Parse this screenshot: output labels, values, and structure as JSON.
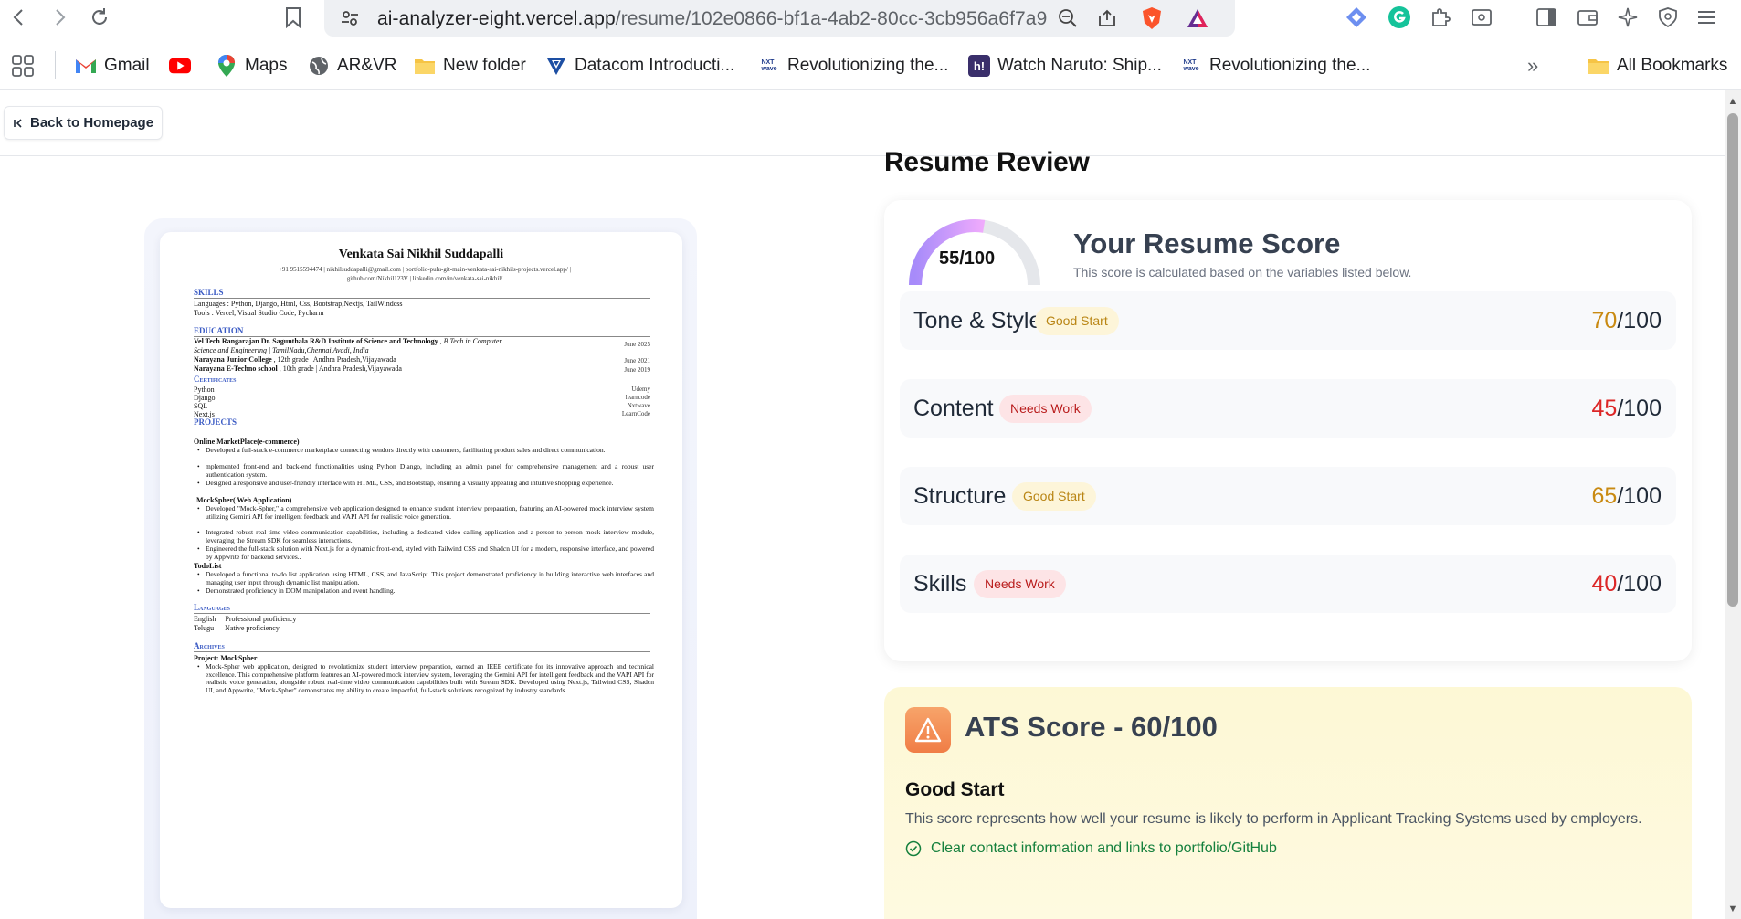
{
  "browser": {
    "url_host": "ai-analyzer-eight.vercel.app",
    "url_path": "/resume/102e0866-bf1a-4ab2-80cc-3cb956a6f7a9",
    "bookmarks": [
      {
        "label": "Gmail",
        "icon": "gmail-icon"
      },
      {
        "label": "",
        "icon": "youtube-icon"
      },
      {
        "label": "Maps",
        "icon": "maps-icon"
      },
      {
        "label": "AR&VR",
        "icon": "globe-icon"
      },
      {
        "label": "New folder",
        "icon": "folder-icon"
      },
      {
        "label": "Datacom Introducti...",
        "icon": "datacom-icon"
      },
      {
        "label": "Revolutionizing the...",
        "icon": "nxtwave-icon"
      },
      {
        "label": "Watch Naruto: Ship...",
        "icon": "hianime-icon"
      },
      {
        "label": "Revolutionizing the...",
        "icon": "nxtwave-icon"
      }
    ],
    "all_bookmarks": "All Bookmarks",
    "more": "»"
  },
  "page": {
    "back_label": "Back to Homepage",
    "title": "Resume Review"
  },
  "resume": {
    "name": "Venkata Sai Nikhil Suddapalli",
    "contact1": "+91 9515594474  |  nikhilsuddapalli@gmail.com  |  portfolio-pulu-git-main-venkata-sai-nikhils-projects.vercel.app/  |",
    "contact2": "github.com/Nikhil123V  |  linkedin.com/in/venkata-sai-nikhil/",
    "sec_skills": "SKILLS",
    "skills_lang": "Languages :    Python, Django, Html, Css, Bootstrap,Nextjs, TailWindcss",
    "skills_tools": "Tools :          Vercel, Visual Studio Code, Pycharm",
    "sec_education": "EDUCATION",
    "edu1_name": "Vel Tech Rangarajan Dr. Sagunthala R&D Institute of Science and Technology",
    "edu1_deg": " , B.Tech in Computer",
    "edu1_line2": "Science and Engineering | TamilNadu,Chennai,Avadi, India",
    "edu1_date": "June 2025",
    "edu2_name": "Narayana Junior College",
    "edu2_rest": " , 12th grade | Andhra Pradesh,Vijayawada",
    "edu2_date": "June 2021",
    "edu3_name": "Narayana E-Techno school",
    "edu3_rest": " , 10th grade | Andhra Pradesh,Vijayawada",
    "edu3_date": "June 2019",
    "sec_certificates": "Certificates",
    "certs": [
      {
        "name": "Python",
        "org": "Udemy"
      },
      {
        "name": "Django",
        "org": "learncode"
      },
      {
        "name": "SQL",
        "org": "Nxtwave"
      },
      {
        "name": "Next.js",
        "org": "LearnCode"
      }
    ],
    "sec_projects": "PROJECTS",
    "proj1_title": "Online MarketPlace(e-commerce)",
    "proj1_b1": "Developed a full-stack e-commerce marketplace connecting vendors directly with customers, facilitating product sales and direct communication.",
    "proj1_b2": "mplemented front-end and back-end functionalities using Python Django, including an admin panel for comprehensive management and a robust user authentication system.",
    "proj1_b3": "Designed a responsive and user-friendly interface with HTML, CSS, and Bootstrap, ensuring a visually appealing and intuitive shopping experience.",
    "proj2_title": "MockSpher( Web Application)",
    "proj2_b1": "Developed \"Mock-Spher,\" a comprehensive web application designed to enhance student interview preparation, featuring an AI-powered mock interview system utilizing Gemini API for intelligent feedback and VAPI API for realistic voice generation.",
    "proj2_b2": "Integrated robust real-time video communication capabilities, including a dedicated video calling application and a person-to-person mock interview module, leveraging the Stream SDK for seamless interactions.",
    "proj2_b3": "Engineered the full-stack solution with Next.js for a dynamic front-end, styled with Tailwind CSS and Shadcn UI for a modern, responsive interface, and powered by Appwrite for backend services..",
    "proj3_title": "TodoList",
    "proj3_b1": "Developed a functional to-do list application using HTML, CSS, and JavaScript. This project demonstrated proficiency in building interactive web interfaces and managing user input through dynamic list manipulation.",
    "proj3_b2": "Demonstrated proficiency in DOM manipulation and event handling.",
    "sec_languages": "Languages",
    "lang1": "English     Professional proficiency",
    "lang2": "Telugu      Native proficiency",
    "sec_archives": "Archives",
    "arch_title": "Project: MockSpher",
    "arch_b1": "Mock-Spher web application, designed to revolutionize student interview preparation, earned an IEEE certificate for its innovative approach and technical excellence. This comprehensive platform features an AI-powered mock interview system, leveraging the Gemini API for intelligent feedback and the VAPI API for realistic voice generation, alongside robust real-time video communication capabilities built with Stream SDK. Developed using Next.js, Tailwind CSS, Shadcn UI, and Appwrite, \"Mock-Spher\" demonstrates my ability to create impactful, full-stack solutions recognized by industry standards."
  },
  "score": {
    "overall_label": "55/100",
    "overall_value": 55,
    "heading": "Your Resume Score",
    "subtitle": "This score is calculated based on the variables listed below.",
    "gauge_color_start": "#a78bfa",
    "gauge_color_end": "#f0abfc",
    "categories": [
      {
        "name": "Tone & Style",
        "badge": "Good Start",
        "tier": "good",
        "score": "70",
        "max": "/100"
      },
      {
        "name": "Content",
        "badge": "Needs Work",
        "tier": "bad",
        "score": "45",
        "max": "/100"
      },
      {
        "name": "Structure",
        "badge": "Good Start",
        "tier": "good",
        "score": "65",
        "max": "/100"
      },
      {
        "name": "Skills",
        "badge": "Needs Work",
        "tier": "bad",
        "score": "40",
        "max": "/100"
      }
    ]
  },
  "ats": {
    "title": "ATS Score - 60/100",
    "status": "Good Start",
    "description": "This score represents how well your resume is likely to perform in Applicant Tracking Systems used by employers.",
    "tip": "Clear contact information and links to portfolio/GitHub",
    "icon": "warning-icon"
  }
}
